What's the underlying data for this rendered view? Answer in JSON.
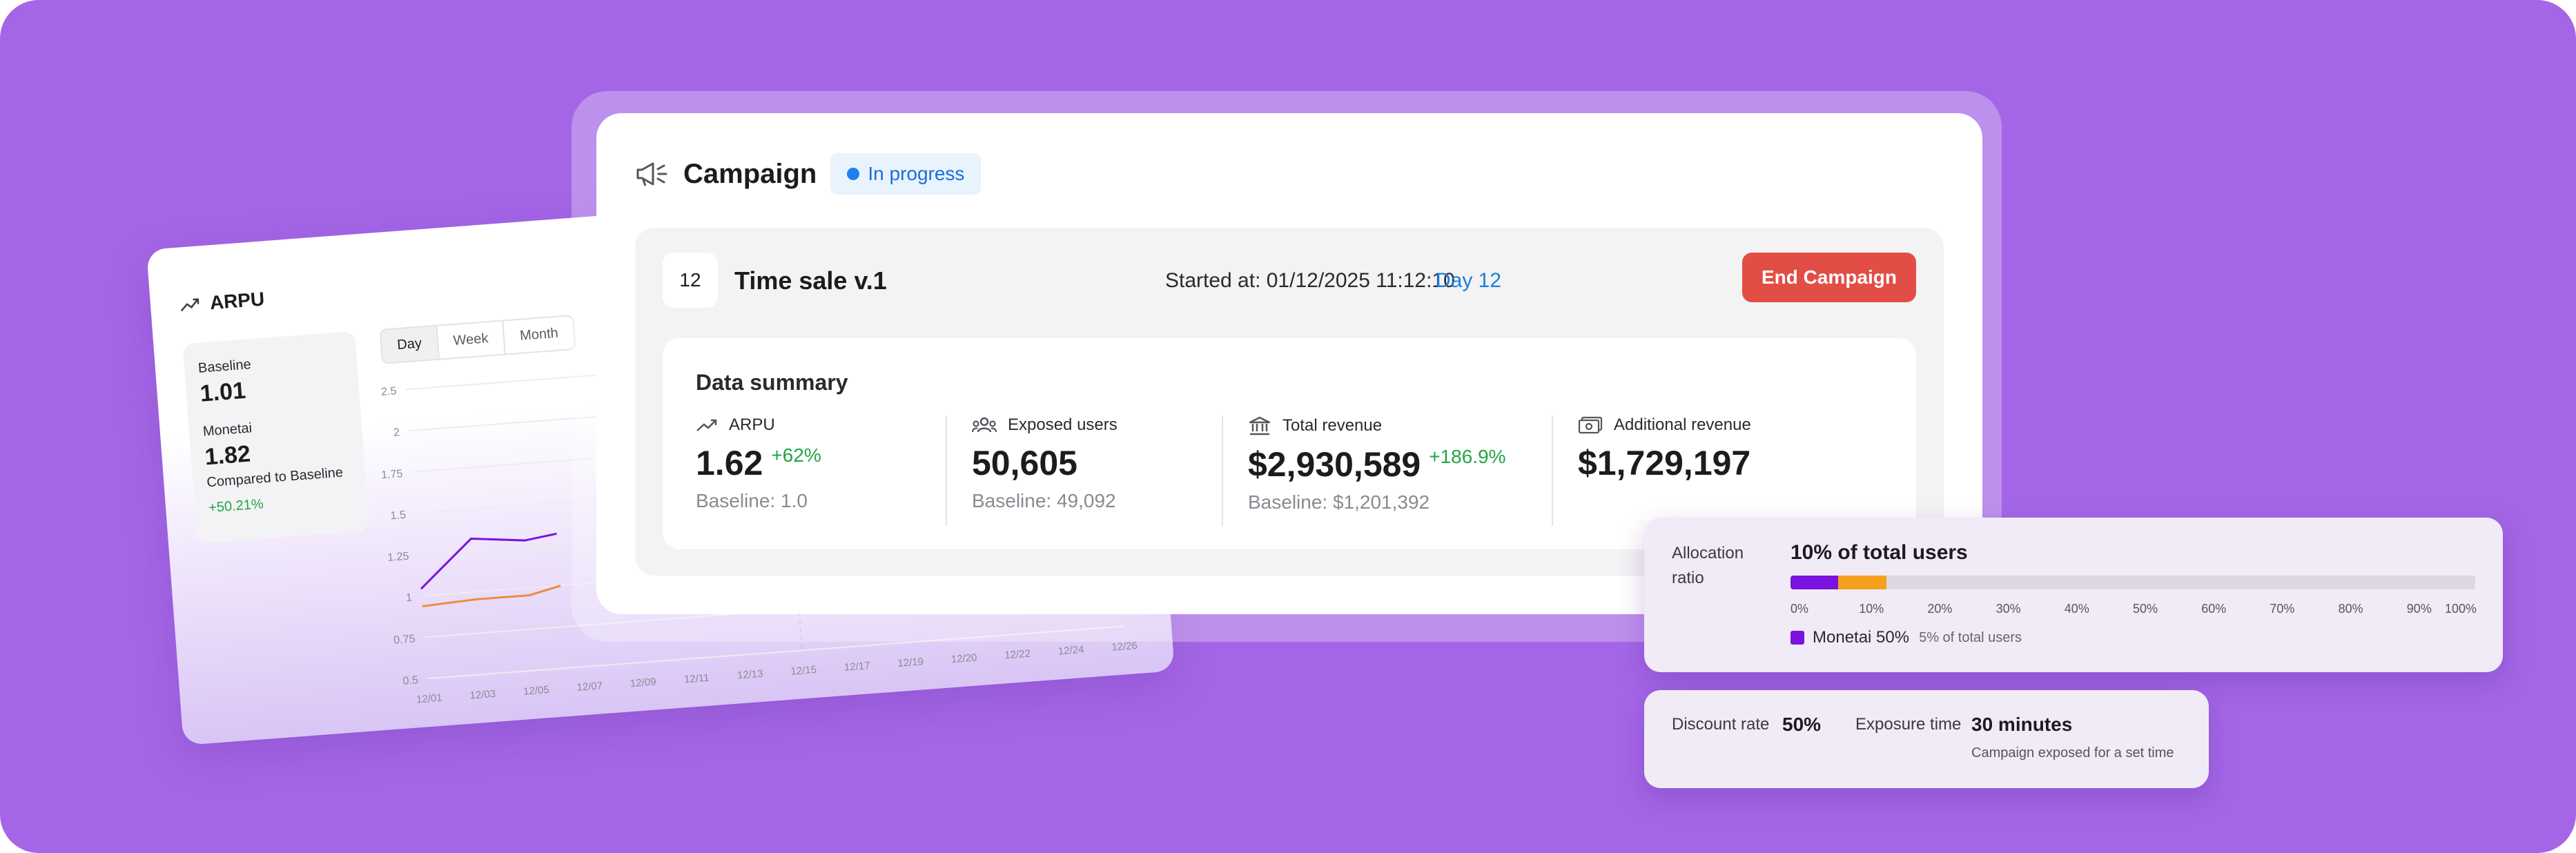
{
  "arpu_panel": {
    "title": "ARPU",
    "baseline_label": "Baseline",
    "baseline_value": "1.01",
    "monetai_label": "Monetai",
    "monetai_value": "1.82",
    "compared_label": "Compared to Baseline",
    "compared_pct": "+50.21%",
    "tabs": [
      "Day",
      "Week",
      "Month"
    ],
    "chart_data": {
      "type": "line",
      "y_ticks": [
        "2.5",
        "2",
        "1.75",
        "1.5",
        "1.25",
        "1",
        "0.75",
        "0.5"
      ],
      "x_ticks": [
        "12/01",
        "12/03",
        "12/05",
        "12/07",
        "12/09",
        "12/11",
        "12/13",
        "12/15",
        "12/17",
        "12/19",
        "12/20",
        "12/22",
        "12/24",
        "12/26"
      ],
      "series": [
        {
          "color": "#7a12e0",
          "points": [
            [
              0,
              1.12
            ],
            [
              1,
              1.44
            ],
            [
              2,
              1.4
            ],
            [
              2.6,
              1.43
            ]
          ]
        },
        {
          "color": "#f08a3c",
          "points": [
            [
              0,
              1.0
            ],
            [
              1,
              1.02
            ],
            [
              2,
              1.02
            ],
            [
              2.6,
              1.07
            ]
          ]
        }
      ],
      "ylim": [
        0.5,
        2.5
      ]
    }
  },
  "campaign": {
    "title": "Campaign",
    "status": "In progress",
    "number": "12",
    "name": "Time sale v.1",
    "started": "Started at: 01/12/2025 11:12:10",
    "day": "Day 12",
    "end_button": "End Campaign",
    "summary_title": "Data summary",
    "metrics": [
      {
        "label": "ARPU",
        "value": "1.62",
        "change": "+62%",
        "baseline": "Baseline: 1.0",
        "icon": "trend-up-icon"
      },
      {
        "label": "Exposed users",
        "value": "50,605",
        "change": "",
        "baseline": "Baseline: 49,092",
        "icon": "users-icon"
      },
      {
        "label": "Total revenue",
        "value": "$2,930,589",
        "change": "+186.9%",
        "baseline": "Baseline: $1,201,392",
        "icon": "bank-icon"
      },
      {
        "label": "Additional revenue",
        "value": "$1,729,197",
        "change": "",
        "baseline": "",
        "icon": "money-icon"
      }
    ]
  },
  "allocation": {
    "label": "Allocation ratio",
    "title": "10% of total users",
    "monetai_fraction": 0.07,
    "second_fraction": 0.07,
    "ticks": [
      "0%",
      "10%",
      "20%",
      "30%",
      "40%",
      "50%",
      "60%",
      "70%",
      "80%",
      "90%",
      "100%"
    ],
    "legend_name": "Monetai 50%",
    "legend_sub": "5% of total users"
  },
  "discount": {
    "discount_label": "Discount rate",
    "discount_value": "50%",
    "exposure_label": "Exposure time",
    "exposure_value": "30 minutes",
    "exposure_note": "Campaign exposed for a set time"
  }
}
